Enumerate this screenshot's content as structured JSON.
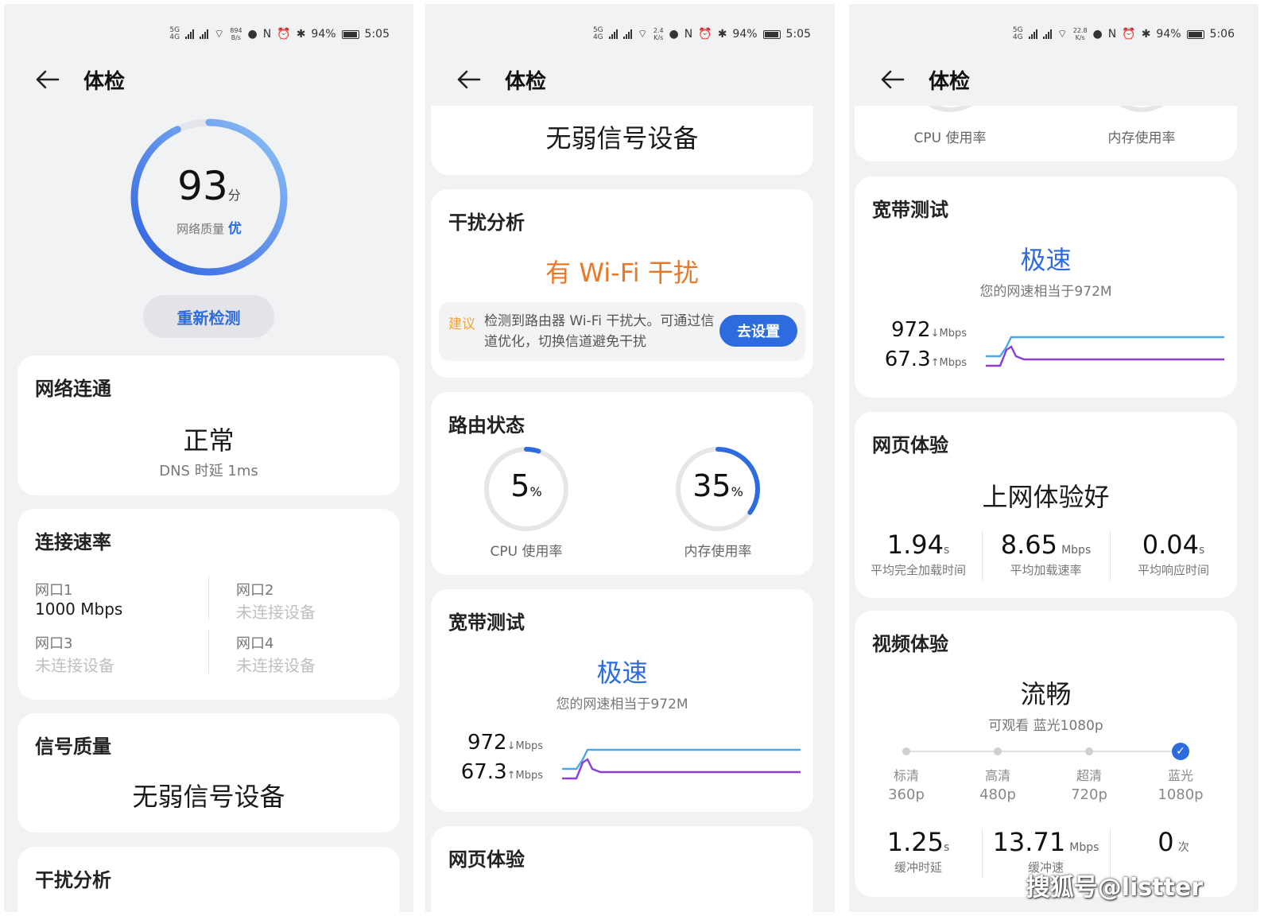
{
  "status": {
    "sim1": "5G",
    "sim2": "4G",
    "p1_speed": "894",
    "p1_speed_unit": "B/s",
    "p2_speed": "2.4",
    "p2_speed_unit": "K/s",
    "p3_speed": "22.8",
    "p3_speed_unit": "K/s",
    "battery": "94%",
    "p1_time": "5:05",
    "p2_time": "5:05",
    "p3_time": "5:06",
    "nfc": "N"
  },
  "title": "体检",
  "score": {
    "value": "93",
    "unit": "分",
    "label": "网络质量",
    "grade": "优",
    "fraction": 0.93
  },
  "recheck_label": "重新检测",
  "network": {
    "title": "网络连通",
    "status": "正常",
    "dns": "DNS 时延 1ms"
  },
  "link_rate": {
    "title": "连接速率",
    "ports": [
      {
        "name": "网口1",
        "value": "1000 Mbps",
        "active": true
      },
      {
        "name": "网口2",
        "value": "未连接设备",
        "active": false
      },
      {
        "name": "网口3",
        "value": "未连接设备",
        "active": false
      },
      {
        "name": "网口4",
        "value": "未连接设备",
        "active": false
      }
    ]
  },
  "signal": {
    "title": "信号质量",
    "status": "无弱信号设备"
  },
  "interference": {
    "title": "干扰分析",
    "status": "有 Wi-Fi 干扰",
    "advice_tag": "建议",
    "advice_text": "检测到路由器 Wi-Fi 干扰大。可通过信道优化，切换信道避免干扰",
    "advice_button": "去设置"
  },
  "router": {
    "title": "路由状态",
    "cpu": {
      "value": "5",
      "unit": "%",
      "label": "CPU 使用率",
      "fraction": 0.05
    },
    "mem": {
      "value": "35",
      "unit": "%",
      "label": "内存使用率",
      "fraction": 0.35
    }
  },
  "broadband": {
    "title": "宽带测试",
    "status": "极速",
    "desc": "您的网速相当于972M",
    "down": "972",
    "down_unit": "↓Mbps",
    "up": "67.3",
    "up_unit": "↑Mbps"
  },
  "web": {
    "title": "网页体验",
    "status": "上网体验好",
    "metrics": [
      {
        "value": "1.94",
        "unit": "s",
        "label": "平均完全加载时间"
      },
      {
        "value": "8.65",
        "unit": "Mbps",
        "label": "平均加载速率"
      },
      {
        "value": "0.04",
        "unit": "s",
        "label": "平均响应时间"
      }
    ]
  },
  "video": {
    "title": "视频体验",
    "status": "流畅",
    "desc": "可观看 蓝光1080p",
    "levels": [
      {
        "name": "标清",
        "res": "360p"
      },
      {
        "name": "高清",
        "res": "480p"
      },
      {
        "name": "超清",
        "res": "720p"
      },
      {
        "name": "蓝光",
        "res": "1080p"
      }
    ],
    "selected_level": 3,
    "metrics": [
      {
        "value": "1.25",
        "unit": "s",
        "label": "缓冲时延"
      },
      {
        "value": "13.71",
        "unit": "Mbps",
        "label": "缓冲速"
      },
      {
        "value": "0",
        "unit": "次",
        "label": ""
      }
    ]
  },
  "watermark": "搜狐号@listter",
  "colors": {
    "accent": "#2d6cdf",
    "warning": "#e8782a",
    "upload_line": "#8a3fd1",
    "download_line": "#4aa8e8"
  }
}
